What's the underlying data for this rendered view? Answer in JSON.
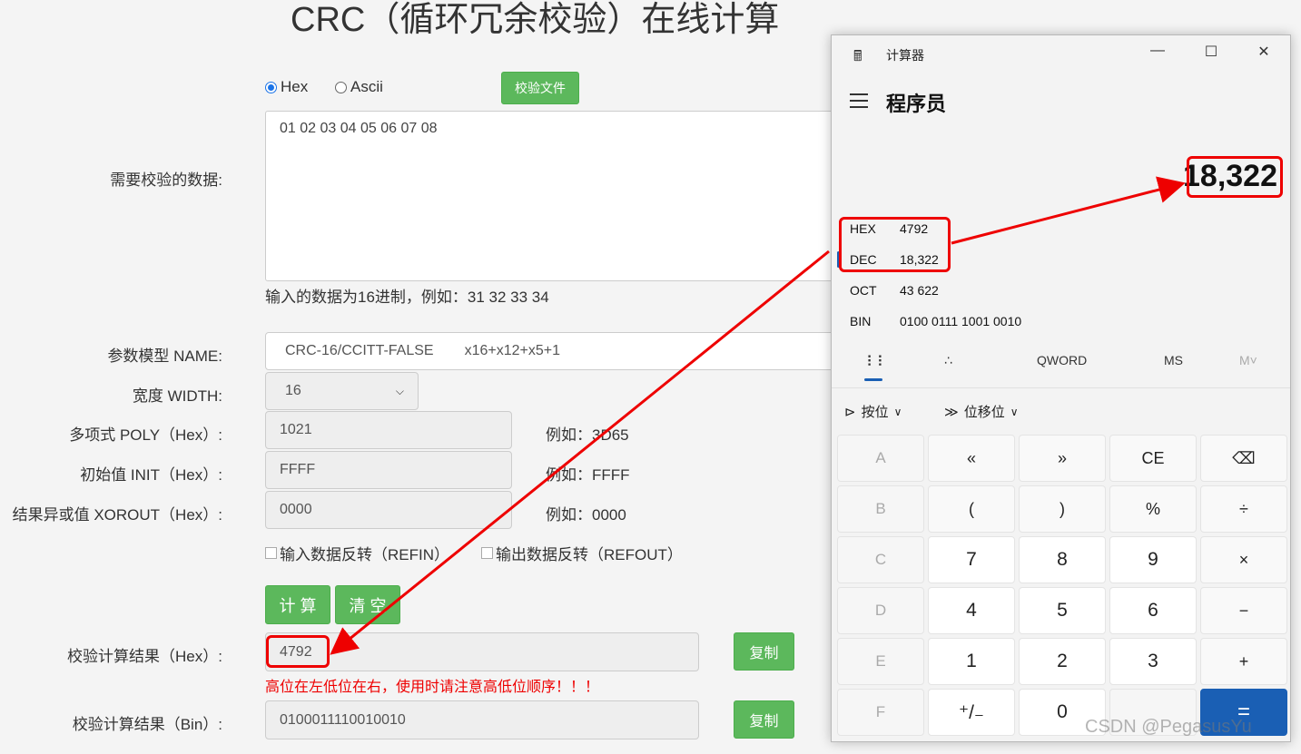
{
  "page": {
    "title": "CRC（循环冗余校验）在线计算",
    "radio_hex": "Hex",
    "radio_ascii": "Ascii",
    "verify_file_button": "校验文件",
    "data_label": "需要校验的数据:",
    "data_value": "01 02 03 04 05 06 07 08",
    "data_hint": "输入的数据为16进制，例如：31 32 33 34",
    "model_label": "参数模型 NAME:",
    "model_value": "CRC-16/CCITT-FALSE",
    "model_poly_text": "x16+x12+x5+1",
    "width_label": "宽度 WIDTH:",
    "width_value": "16",
    "poly_label": "多项式 POLY（Hex）:",
    "poly_value": "1021",
    "poly_hint": "例如：3D65",
    "init_label": "初始值 INIT（Hex）:",
    "init_value": "FFFF",
    "init_hint": "例如：FFFF",
    "xorout_label": "结果异或值 XOROUT（Hex）:",
    "xorout_value": "0000",
    "xorout_hint": "例如：0000",
    "refin_label": "输入数据反转（REFIN）",
    "refout_label": "输出数据反转（REFOUT）",
    "calc_button": "计 算",
    "clear_button": "清 空",
    "result_hex_label": "校验计算结果（Hex）:",
    "result_hex_value": "4792",
    "copy_button": "复制",
    "order_note": "高位在左低位在右，使用时请注意高低位顺序！！！",
    "result_bin_label": "校验计算结果（Bin）:",
    "result_bin_value": "0100011110010010"
  },
  "calculator": {
    "window_title": "计算器",
    "mode": "程序员",
    "display": "18,322",
    "radix": [
      {
        "name": "HEX",
        "value": "4792"
      },
      {
        "name": "DEC",
        "value": "18,322"
      },
      {
        "name": "OCT",
        "value": "43 622"
      },
      {
        "name": "BIN",
        "value": "0100 0111 1001 0010"
      }
    ],
    "word_size": "QWORD",
    "ms": "MS",
    "mv": "M˅",
    "bitwise": "按位",
    "bitshift": "位移位",
    "keys": [
      "A",
      "«",
      "»",
      "CE",
      "⌫",
      "B",
      "(",
      ")",
      "%",
      "÷",
      "C",
      "7",
      "8",
      "9",
      "×",
      "D",
      "4",
      "5",
      "6",
      "−",
      "E",
      "1",
      "2",
      "3",
      "+",
      "F",
      "⁺/₋",
      "0",
      "",
      "="
    ]
  },
  "watermark": "CSDN @PegasusYu"
}
